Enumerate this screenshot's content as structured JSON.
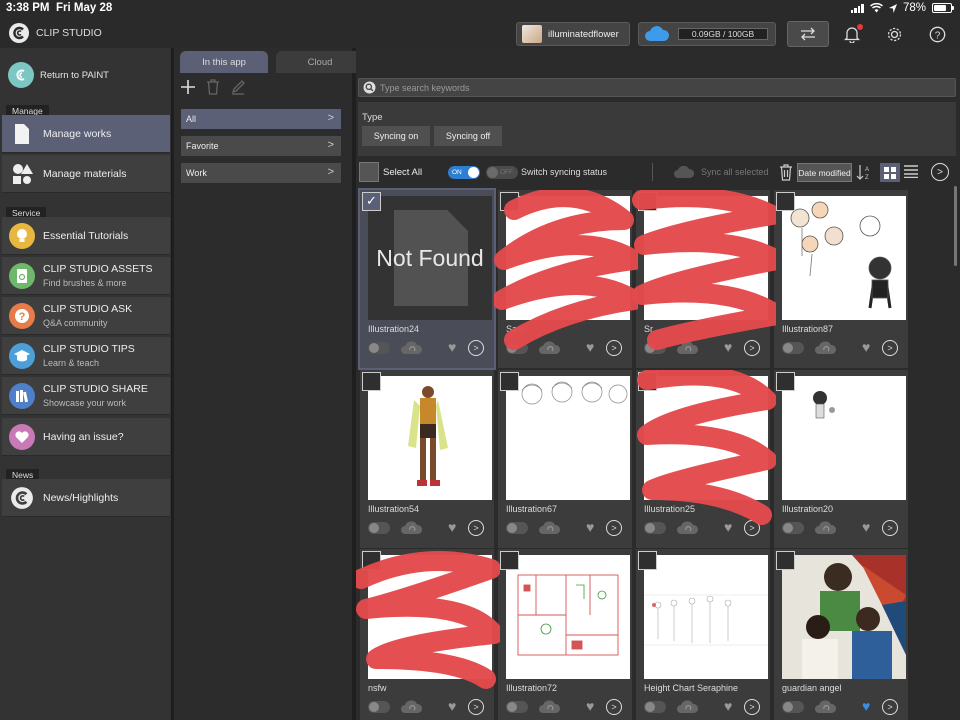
{
  "status_bar": {
    "time": "3:38 PM",
    "date": "Fri May 28",
    "battery_percent": "78%"
  },
  "app": {
    "title": "CLIP STUDIO",
    "username": "illuminatedflower",
    "storage": "0.09GB / 100GB",
    "notification_dot_color": "#e8383c"
  },
  "sidebar": {
    "return_label": "Return to PAINT",
    "sections": {
      "manage": "Manage",
      "service": "Service",
      "news": "News"
    },
    "manage_items": [
      {
        "label": "Manage works",
        "icon": "document-icon"
      },
      {
        "label": "Manage materials",
        "icon": "shapes-icon"
      }
    ],
    "service_items": [
      {
        "label": "Essential Tutorials",
        "sub": "",
        "icon": "lightbulb-icon"
      },
      {
        "label": "CLIP STUDIO ASSETS",
        "sub": "Find brushes & more",
        "icon": "assets-icon"
      },
      {
        "label": "CLIP STUDIO ASK",
        "sub": "Q&A community",
        "icon": "question-icon"
      },
      {
        "label": "CLIP STUDIO TIPS",
        "sub": "Learn & teach",
        "icon": "graduation-cap-icon"
      },
      {
        "label": "CLIP STUDIO SHARE",
        "sub": "Showcase your work",
        "icon": "books-icon"
      },
      {
        "label": "Having an issue?",
        "sub": "",
        "icon": "heart-hand-icon"
      }
    ],
    "news_items": [
      {
        "label": "News/Highlights",
        "icon": "clip-logo-icon"
      }
    ]
  },
  "folders": {
    "tabs": [
      "In this app",
      "Cloud"
    ],
    "items": [
      "All",
      "Favorite",
      "Work"
    ]
  },
  "main": {
    "search_placeholder": "Type search keywords",
    "type_label": "Type",
    "filter_chips": [
      "Syncing on",
      "Syncing off"
    ],
    "select_all": "Select All",
    "toggle_on": "ON",
    "toggle_off": "OFF",
    "switch_label": "Switch syncing status",
    "sync_all_selected": "Sync all selected",
    "sort_value": "Date modified",
    "accent_color": "#5b6077"
  },
  "works": [
    {
      "name": "Illustration24",
      "thumb": "not-found",
      "not_found_text": "Not Found",
      "checked": true,
      "favorite": false
    },
    {
      "name": "Sara",
      "thumb": "redacted",
      "checked": false,
      "favorite": false
    },
    {
      "name": "Sr",
      "thumb": "redacted",
      "checked": false,
      "favorite": false
    },
    {
      "name": "Illustration87",
      "thumb": "chibi-sketch",
      "checked": false,
      "favorite": false
    },
    {
      "name": "Illustration54",
      "thumb": "figure",
      "checked": false,
      "favorite": false
    },
    {
      "name": "Illustration67",
      "thumb": "sketch-heads",
      "checked": false,
      "favorite": false
    },
    {
      "name": "Illustration25",
      "thumb": "redacted",
      "checked": false,
      "favorite": false
    },
    {
      "name": "Illustration20",
      "thumb": "small-doodle",
      "checked": false,
      "favorite": false
    },
    {
      "name": "nsfw",
      "thumb": "redacted",
      "checked": false,
      "favorite": false
    },
    {
      "name": "Illustration72",
      "thumb": "floorplan",
      "checked": false,
      "favorite": false
    },
    {
      "name": "Height Chart Seraphine",
      "thumb": "height-chart",
      "checked": false,
      "favorite": false
    },
    {
      "name": "guardian angel",
      "thumb": "painting",
      "checked": false,
      "favorite": true
    }
  ]
}
